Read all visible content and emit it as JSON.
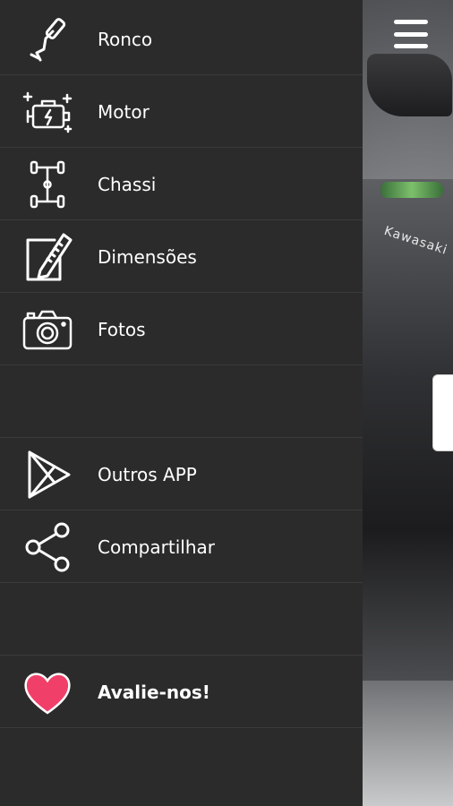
{
  "menu": {
    "items": [
      {
        "label": "Ronco",
        "icon": "exhaust-icon"
      },
      {
        "label": "Motor",
        "icon": "engine-icon"
      },
      {
        "label": "Chassi",
        "icon": "chassis-icon"
      },
      {
        "label": "Dimensões",
        "icon": "ruler-icon"
      },
      {
        "label": "Fotos",
        "icon": "camera-icon"
      },
      {
        "label": "Outros APP",
        "icon": "play-store-icon"
      },
      {
        "label": "Compartilhar",
        "icon": "share-icon"
      },
      {
        "label": "Avalie-nos!",
        "icon": "heart-icon"
      }
    ]
  },
  "background": {
    "brand_text": "Kawasaki"
  },
  "colors": {
    "drawer_bg": "#2b2b2b",
    "divider": "#3b3b3b",
    "text": "#ffffff",
    "heart": "#f0406a"
  }
}
